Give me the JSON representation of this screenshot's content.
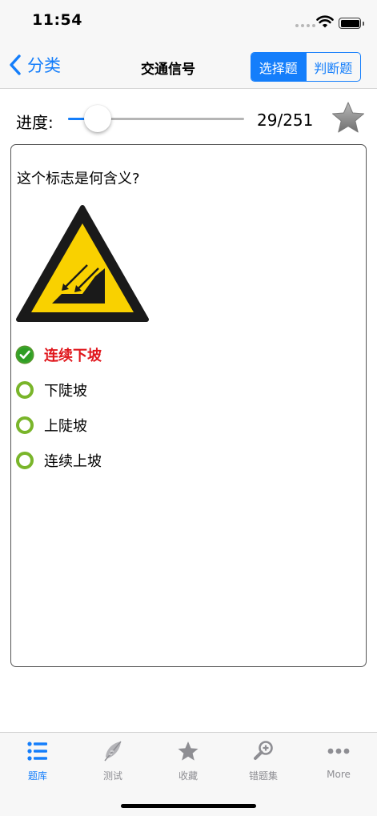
{
  "status_bar": {
    "time": "11:54"
  },
  "nav": {
    "back_label": "分类",
    "title": "交通信号",
    "segments": [
      "选择题",
      "判断题"
    ],
    "active_segment": 0
  },
  "progress": {
    "label": "进度:",
    "current": 29,
    "total": 251,
    "count_text": "29/251",
    "slider_fraction": 0.17
  },
  "question": {
    "text": "这个标志是何含义?",
    "options": [
      {
        "label": "连续下坡",
        "state": "correct"
      },
      {
        "label": "下陡坡",
        "state": "unselected"
      },
      {
        "label": "上陡坡",
        "state": "unselected"
      },
      {
        "label": "连续上坡",
        "state": "unselected"
      }
    ]
  },
  "tab_bar": {
    "items": [
      {
        "label": "题库",
        "icon": "list-icon",
        "active": true
      },
      {
        "label": "测试",
        "icon": "feather-icon",
        "active": false
      },
      {
        "label": "收藏",
        "icon": "star-icon",
        "active": false
      },
      {
        "label": "错题集",
        "icon": "magnifier-plus-icon",
        "active": false
      },
      {
        "label": "More",
        "icon": "more-dots-icon",
        "active": false
      }
    ]
  },
  "colors": {
    "accent": "#147efb",
    "correct_text": "#e0161c",
    "warning_yellow": "#f9d100",
    "option_ring": "#79b52a"
  }
}
